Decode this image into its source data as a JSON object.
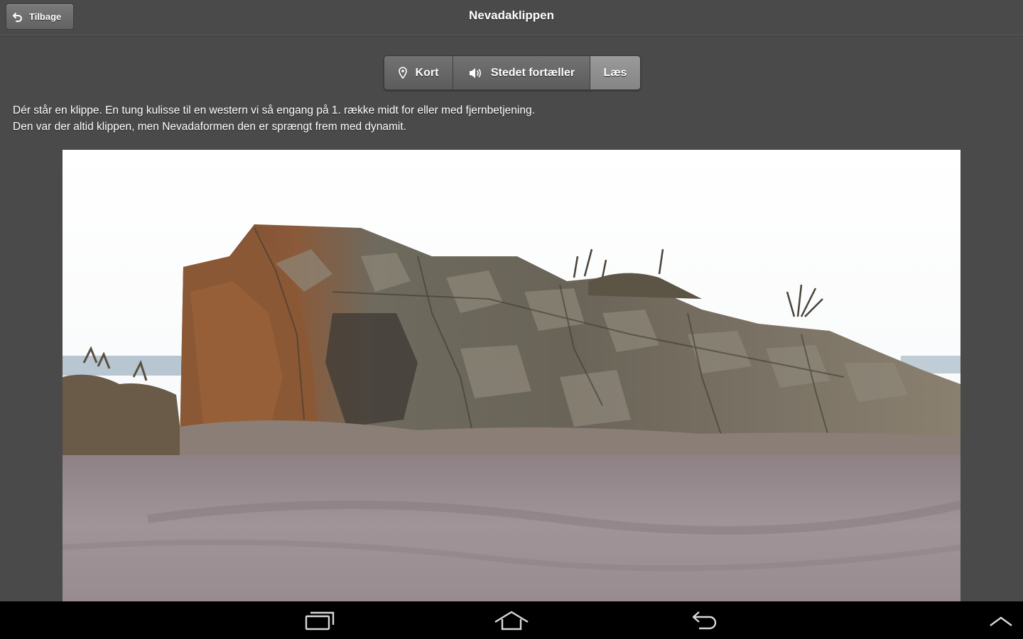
{
  "header": {
    "back_label": "Tilbage",
    "title": "Nevadaklippen"
  },
  "tabs": [
    {
      "label": "Kort",
      "icon": "map-pin-icon",
      "active": false
    },
    {
      "label": "Stedet fortæller",
      "icon": "speaker-icon",
      "active": false
    },
    {
      "label": "Læs",
      "icon": "",
      "active": true
    }
  ],
  "content": {
    "lines": [
      "Dér står en klippe. En tung kulisse til en western vi så engang på 1. række midt for eller med fjernbetjening.",
      "Den var der altid klippen, men Nevadaformen den er sprængt frem med dynamit."
    ]
  },
  "navbar": {
    "buttons": [
      "recent-apps-icon",
      "home-icon",
      "back-icon",
      "chevron-up-icon"
    ]
  },
  "colors": {
    "background": "#4a4a4a",
    "button": "#6a6a6a",
    "active_tab": "#8e8e8e",
    "navbar": "#000000"
  }
}
